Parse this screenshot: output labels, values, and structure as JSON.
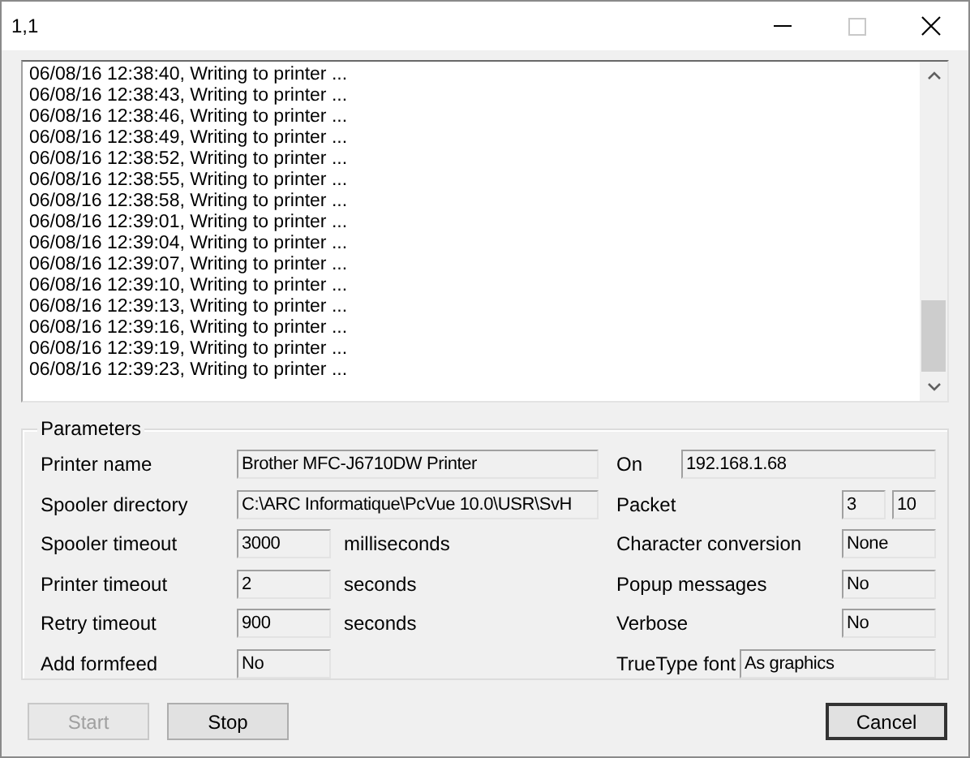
{
  "window": {
    "title": "1,1",
    "maximize_disabled": true
  },
  "log": {
    "lines": [
      "06/08/16 12:38:40, Writing to printer ...",
      "06/08/16 12:38:43, Writing to printer ...",
      "06/08/16 12:38:46, Writing to printer ...",
      "06/08/16 12:38:49, Writing to printer ...",
      "06/08/16 12:38:52, Writing to printer ...",
      "06/08/16 12:38:55, Writing to printer ...",
      "06/08/16 12:38:58, Writing to printer ...",
      "06/08/16 12:39:01, Writing to printer ...",
      "06/08/16 12:39:04, Writing to printer ...",
      "06/08/16 12:39:07, Writing to printer ...",
      "06/08/16 12:39:10, Writing to printer ...",
      "06/08/16 12:39:13, Writing to printer ...",
      "06/08/16 12:39:16, Writing to printer ...",
      "06/08/16 12:39:19, Writing to printer ...",
      "06/08/16 12:39:23, Writing to printer ..."
    ]
  },
  "parameters": {
    "title": "Parameters",
    "left": [
      {
        "label": "Printer name",
        "kind": "wide",
        "values": [
          "Brother MFC-J6710DW Printer"
        ]
      },
      {
        "label": "Spooler directory",
        "kind": "wide",
        "values": [
          "C:\\ARC Informatique\\PcVue 10.0\\USR\\SvH"
        ]
      },
      {
        "label": "Spooler timeout",
        "kind": "short",
        "values": [
          "3000"
        ],
        "unit": "milliseconds"
      },
      {
        "label": "Printer timeout",
        "kind": "short",
        "values": [
          "2"
        ],
        "unit": "seconds"
      },
      {
        "label": "Retry timeout",
        "kind": "short",
        "values": [
          "900"
        ],
        "unit": "seconds"
      },
      {
        "label": "Add formfeed",
        "kind": "short",
        "values": [
          "No"
        ]
      }
    ],
    "right": [
      {
        "label": "On",
        "kind": "long",
        "values": [
          "192.168.1.68"
        ]
      },
      {
        "label": "Packet",
        "kind": "pair",
        "values": [
          "3",
          "10"
        ]
      },
      {
        "label": "Character conversion",
        "kind": "short",
        "values": [
          "None"
        ]
      },
      {
        "label": "Popup messages",
        "kind": "short",
        "values": [
          "No"
        ]
      },
      {
        "label": "Verbose",
        "kind": "short",
        "values": [
          "No"
        ]
      },
      {
        "label": "TrueType font",
        "kind": "medium",
        "values": [
          "As graphics"
        ]
      }
    ]
  },
  "buttons": [
    {
      "label": "Start",
      "disabled": true,
      "default": false
    },
    {
      "label": "Stop",
      "disabled": false,
      "default": false
    },
    {
      "label": "Cancel",
      "disabled": false,
      "default": true
    }
  ]
}
